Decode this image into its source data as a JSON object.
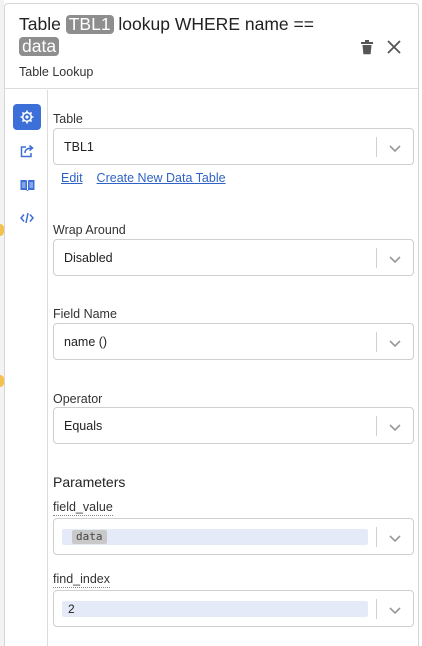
{
  "header": {
    "title_prefix": "Table",
    "title_table_chip": "TBL1",
    "title_middle": "lookup WHERE name ==",
    "title_value_chip": "data",
    "subtitle": "Table Lookup"
  },
  "icons": {
    "delete": "trash-icon",
    "close": "close-icon",
    "settings": "gear-icon",
    "output": "share-icon",
    "docs": "book-icon",
    "code": "code-icon"
  },
  "colors": {
    "accent": "#3d6fd9",
    "link": "#2f63c6",
    "chip": "#8e8e8e",
    "input_fill": "#e4eaf8"
  },
  "form": {
    "table": {
      "label": "Table",
      "value": "TBL1"
    },
    "links": {
      "edit": "Edit",
      "create": "Create New Data Table"
    },
    "wrap_around": {
      "label": "Wrap Around",
      "value": "Disabled"
    },
    "field_name": {
      "label": "Field Name",
      "value": "name ()"
    },
    "operator": {
      "label": "Operator",
      "value": "Equals"
    },
    "parameters": {
      "heading": "Parameters",
      "field_value": {
        "label": "field_value",
        "value": "data"
      },
      "find_index": {
        "label": "find_index",
        "value": "2"
      }
    }
  }
}
